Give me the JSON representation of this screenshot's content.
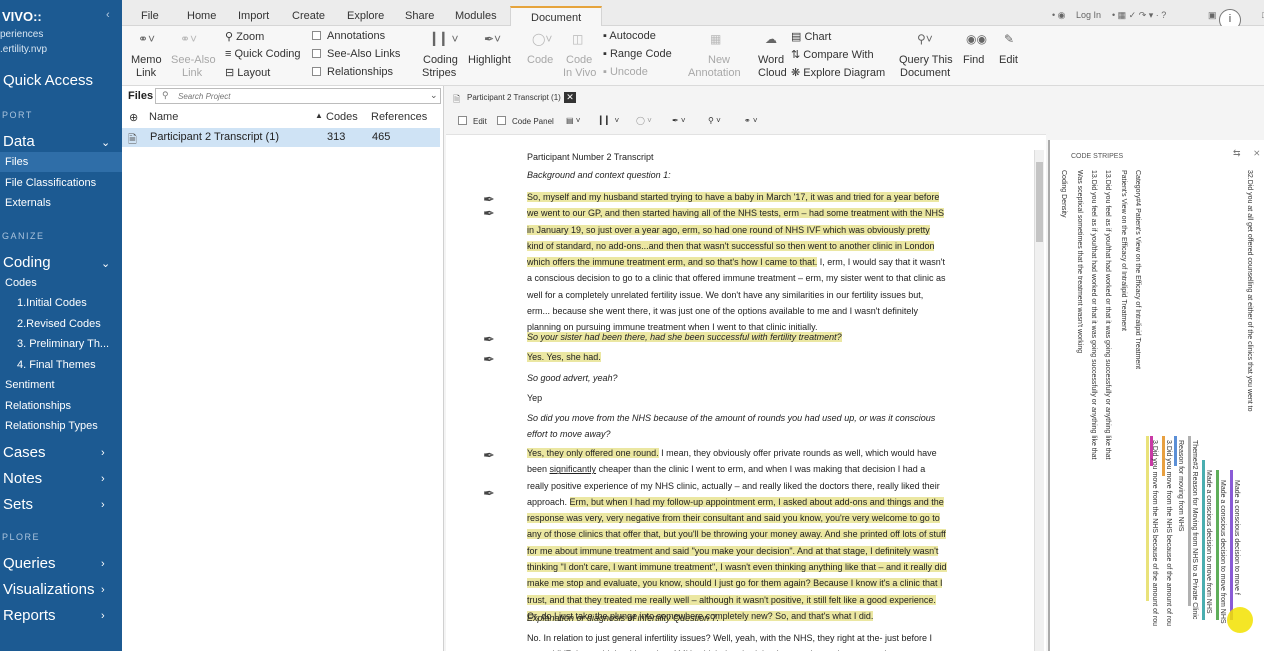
{
  "sidebar": {
    "logo": "VIVO::",
    "project_line1": "periences",
    "project_line2": ".ertility.nvp",
    "quick_access": "Quick Access",
    "sec_import": "PORT",
    "data": "Data",
    "files": "Files",
    "file_classifications": "File Classifications",
    "externals": "Externals",
    "sec_organize": "GANIZE",
    "coding": "Coding",
    "codes": "Codes",
    "code_sets": [
      "1.Initial Codes",
      "2.Revised Codes",
      "3. Preliminary Th...",
      "4. Final Themes"
    ],
    "sentiment": "Sentiment",
    "relationships": "Relationships",
    "relationship_types": "Relationship Types",
    "cases": "Cases",
    "notes": "Notes",
    "sets": "Sets",
    "sec_explore": "PLORE",
    "queries": "Queries",
    "visualizations": "Visualizations",
    "reports": "Reports"
  },
  "menu": {
    "tabs": [
      "File",
      "Home",
      "Import",
      "Create",
      "Explore",
      "Share",
      "Modules",
      "Document"
    ],
    "active": "Document",
    "right": {
      "login": "Log In",
      "help": "i"
    }
  },
  "ribbon": {
    "memo_link": [
      "Memo",
      "Link"
    ],
    "see_also_link": [
      "See-Also",
      "Link"
    ],
    "zoom": "Zoom",
    "quick_coding": "Quick Coding",
    "layout": "Layout",
    "annotations": "Annotations",
    "see_also_links": "See-Also Links",
    "relationships": "Relationships",
    "coding_stripes": [
      "Coding",
      "Stripes"
    ],
    "highlight": "Highlight",
    "code": "Code",
    "code_in_vivo": [
      "Code",
      "In Vivo"
    ],
    "autocode": "Autocode",
    "range_code": "Range Code",
    "uncode": "Uncode",
    "new_annotation": [
      "New",
      "Annotation"
    ],
    "word_cloud": [
      "Word",
      "Cloud"
    ],
    "chart": "Chart",
    "compare_with": "Compare With",
    "explore_diagram": "Explore Diagram",
    "query_this_document": [
      "Query This",
      "Document"
    ],
    "find": "Find",
    "edit": "Edit"
  },
  "files_pane": {
    "title": "Files",
    "search_placeholder": "Search Project",
    "columns": {
      "name": "Name",
      "codes": "Codes",
      "references": "References"
    },
    "rows": [
      {
        "name": "Participant 2 Transcript (1)",
        "codes": "313",
        "references": "465"
      }
    ]
  },
  "document": {
    "tab_label": "Participant 2 Transcript (1)",
    "tools": {
      "edit": "Edit",
      "code_panel": "Code Panel"
    },
    "title": "Participant Number 2 Transcript",
    "q1": "Background and context question 1:",
    "p1_hl": "So, myself and my husband started trying to have a baby in March '17, it was and tried for a year before we went to our GP, and then started having all of the NHS tests, erm – had some treatment with the NHS in January 19, so just over a year ago, erm, so had one round of NHS IVF which was obviously pretty kind of standard, no add-ons...and then that wasn't successful so then went to another clinic in London which offers the immune treatment erm, and so that's how I came to that.",
    "p1_rest": " I, erm, I would say that it wasn't a conscious decision to go to a clinic that offered immune treatment – erm, my sister went to that clinic as well for a completely unrelated fertility issue. We don't have any similarities in our fertility issues but, erm... because she went there, it was just one of the options available to me and I wasn't definitely planning on pursuing immune treatment when I went to that clinic initially.",
    "q2": "So your sister had been there, had she been successful with fertility treatment?",
    "a2": "Yes. Yes, she had.",
    "q3": "So good advert, yeah?",
    "a3": "Yep",
    "q4": "So did you move from the NHS because of the amount of rounds you had used up, or was it conscious effort to move away?",
    "p4_hl1": "Yes, they only offered one round.",
    "p4_a": " I mean, they obviously offer private rounds as well, which would have been ",
    "p4_sig": "significantly",
    "p4_b": " cheaper than the clinic I went to erm, and when I was making that decision I had a really positive experience of my NHS clinic, actually – and really liked the doctors there, really liked their approach. ",
    "p4_hl2": "Erm, but when I had my follow-up appointment erm, I asked about add-ons and things and the response was very, very negative from their consultant and said you know, you're very welcome to go to any of those clinics that offer that, but you'll be throwing your money away. And she printed off lots of stuff for me about immune treatment and said \"you make your decision\". And at that stage, I definitely wasn't thinking \"I don't care, I want immune treatment\", I wasn't even thinking anything like that – and it really did make me stop and evaluate, you know, should I just go for them again? Because I know it's a clinic that I trust, and that they treated me really well – although it wasn't positive, it still felt like a good experience. Or, do I just take the plunge into somewhere completely new? So, and that's what I did.",
    "q5": "Explanation or diagnosis of infertility Question 7.",
    "p5": "No. In relation to just general infertility issues? Well, yeah, with the NHS, they right at the- just before I started IVF they said that I have low AMH, which they hadn't – I guess they only measured"
  },
  "stripes": {
    "title": "CODE STRIPES",
    "coding_density": "Coding Density",
    "labels_a": [
      "Was sceptical sometimes that the treatment wasn't working",
      "13.Did you feel as if you/that had worked or that it was going successfully or anything like that",
      "13.Did you feel as if you/that had worked or that it was going successfully or anything like that",
      "Patient's View on the Efficacy of Intralipid Treatment",
      "Category#4 Patient's View on the Efficacy of Intralipid Treatment"
    ],
    "labels_b": [
      "3.Did you move from the NHS because of the amount of rou",
      "3.Did you move from the NHS because of the amount of rou",
      "Reason for moving from NHS",
      "Theme#2 Reason for Moving from NHS to a Private Clinic",
      "Made a conscious decision to move from NHS",
      "Made a conscious decision to move from NHS",
      "Made a conscious decision to move f"
    ],
    "right_edge": "32.Did you at all get offered counselling at either of the clinics that you went to",
    "colors": {
      "yellow": "#e9e27a",
      "pink": "#c93aa6",
      "orange": "#e8a040",
      "blue": "#5b8fd6",
      "green": "#5fae5a",
      "purple": "#8a5bd6",
      "teal": "#4aaeb0",
      "grey": "#b0b0b0"
    }
  }
}
